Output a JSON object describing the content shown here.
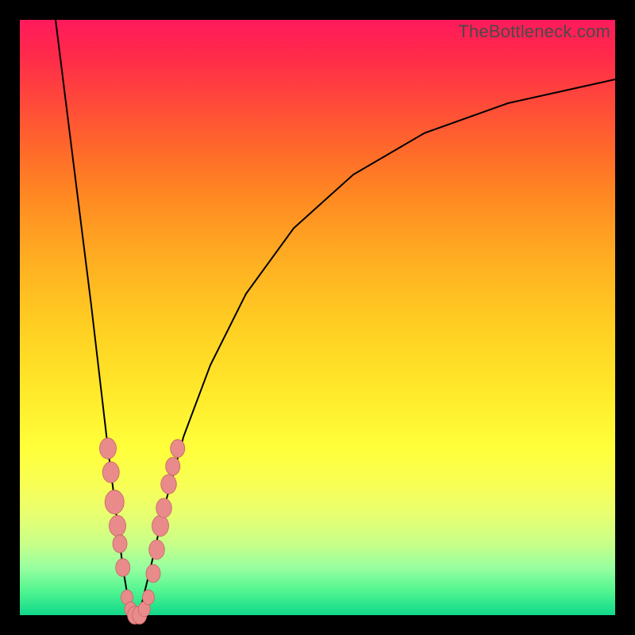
{
  "watermark": "TheBottleneck.com",
  "colors": {
    "frame": "#000000",
    "curve": "#000000",
    "marker_fill": "#e98b8b",
    "marker_stroke": "#c86a6a"
  },
  "chart_data": {
    "type": "line",
    "title": "",
    "xlabel": "",
    "ylabel": "",
    "xlim": [
      0,
      100
    ],
    "ylim": [
      0,
      100
    ],
    "grid": false,
    "note": "V-shaped bottleneck curve with no labeled axes; y is better (green) toward 0. Values are approximate positions read off the 100×100 coordinate plane.",
    "curve": {
      "left_branch": [
        {
          "x": 6,
          "y": 100
        },
        {
          "x": 8,
          "y": 84
        },
        {
          "x": 10,
          "y": 68
        },
        {
          "x": 12,
          "y": 52
        },
        {
          "x": 13.4,
          "y": 40
        },
        {
          "x": 14.8,
          "y": 28
        },
        {
          "x": 16.2,
          "y": 17
        },
        {
          "x": 17.3,
          "y": 8
        },
        {
          "x": 18.3,
          "y": 2
        },
        {
          "x": 19.3,
          "y": 0
        }
      ],
      "right_branch": [
        {
          "x": 19.3,
          "y": 0
        },
        {
          "x": 20.5,
          "y": 2
        },
        {
          "x": 22.2,
          "y": 9
        },
        {
          "x": 24.5,
          "y": 19
        },
        {
          "x": 27.5,
          "y": 30
        },
        {
          "x": 32,
          "y": 42
        },
        {
          "x": 38,
          "y": 54
        },
        {
          "x": 46,
          "y": 65
        },
        {
          "x": 56,
          "y": 74
        },
        {
          "x": 68,
          "y": 81
        },
        {
          "x": 82,
          "y": 86
        },
        {
          "x": 100,
          "y": 90
        }
      ]
    },
    "markers": [
      {
        "x": 14.8,
        "y": 28,
        "r": 1.4
      },
      {
        "x": 15.3,
        "y": 24,
        "r": 1.4
      },
      {
        "x": 15.9,
        "y": 19,
        "r": 1.6
      },
      {
        "x": 16.4,
        "y": 15,
        "r": 1.4
      },
      {
        "x": 16.8,
        "y": 12,
        "r": 1.2
      },
      {
        "x": 17.3,
        "y": 8,
        "r": 1.2
      },
      {
        "x": 18.0,
        "y": 3,
        "r": 1.0
      },
      {
        "x": 18.6,
        "y": 1,
        "r": 1.0
      },
      {
        "x": 19.3,
        "y": 0,
        "r": 1.2
      },
      {
        "x": 20.1,
        "y": 0,
        "r": 1.2
      },
      {
        "x": 20.9,
        "y": 1,
        "r": 1.0
      },
      {
        "x": 21.6,
        "y": 3,
        "r": 1.0
      },
      {
        "x": 22.4,
        "y": 7,
        "r": 1.2
      },
      {
        "x": 23.0,
        "y": 11,
        "r": 1.3
      },
      {
        "x": 23.6,
        "y": 15,
        "r": 1.4
      },
      {
        "x": 24.2,
        "y": 18,
        "r": 1.3
      },
      {
        "x": 25.0,
        "y": 22,
        "r": 1.3
      },
      {
        "x": 25.7,
        "y": 25,
        "r": 1.2
      },
      {
        "x": 26.5,
        "y": 28,
        "r": 1.2
      }
    ]
  }
}
